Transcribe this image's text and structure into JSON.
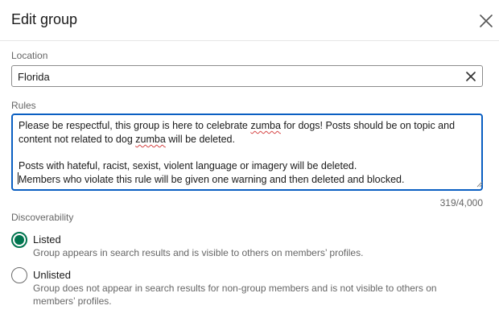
{
  "dialog": {
    "title": "Edit group",
    "close_icon": "close-icon"
  },
  "location": {
    "label": "Location",
    "value": "Florida",
    "clear_icon": "clear-icon"
  },
  "rules": {
    "label": "Rules",
    "lines": [
      {
        "before": "Please be respectful, this group is here to celebrate ",
        "flagged": "zumba",
        "after": " for dogs! Posts should be on topic and"
      },
      {
        "before": "content not related to dog ",
        "flagged": "zumba",
        "after": " will be deleted."
      },
      {
        "text": "Posts with hateful, racist, sexist, violent language or imagery will be deleted."
      },
      {
        "text": "Members who violate this rule will be given one warning and then deleted and blocked."
      }
    ],
    "counter": "319/4,000"
  },
  "discoverability": {
    "label": "Discoverability",
    "options": [
      {
        "label": "Listed",
        "description": "Group appears in search results and is visible to others on members’ profiles.",
        "selected": true
      },
      {
        "label": "Unlisted",
        "description": "Group does not appear in search results for non-group members and is not visible to others on members’ profiles.",
        "selected": false
      }
    ]
  },
  "colors": {
    "accent": "#0a5fc2",
    "radio_selected": "#01754f",
    "spell_error": "#d64545"
  }
}
